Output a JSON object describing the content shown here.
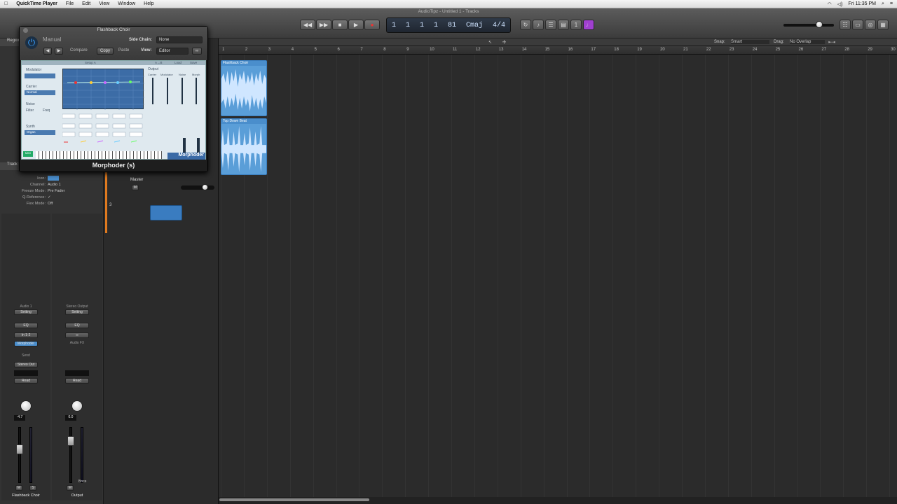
{
  "menubar": {
    "apple": "",
    "app": "QuickTime Player",
    "items": [
      "File",
      "Edit",
      "View",
      "Window",
      "Help"
    ],
    "clock": "Fri 11:35 PM"
  },
  "window_title": "AudioTipz - Untitled 1 - Tracks",
  "lcd": {
    "bar": "1",
    "beat": "1",
    "div": "1",
    "tick": "1",
    "tempo": "81",
    "key": "Cmaj",
    "sig": "4/4"
  },
  "toolbar": {
    "snap_label": "Snap:",
    "snap_value": "Smart",
    "drag_label": "Drag:",
    "drag_value": "No Overlap"
  },
  "plugin": {
    "title": "Flashback Choir",
    "preset": "Manual",
    "side_chain_label": "Side Chain:",
    "side_chain_value": "None",
    "compare": "Compare",
    "copy": "Copy",
    "paste": "Paste",
    "view_label": "View:",
    "view_value": "Editor",
    "setup": "Setup A",
    "load": "Load",
    "save": "Save",
    "ab": "A→B",
    "modulator": "Modulator",
    "carrier": "Carrier",
    "carrier_value": "Normal",
    "noise": "Noise",
    "filter": "Filter",
    "freq": "Freq",
    "synth": "Synth",
    "synth_value": "Organ",
    "output": "Output",
    "output_cols": [
      "Carrier",
      "Modulator",
      "Noise",
      "Morph"
    ],
    "brand": "Morphoder",
    "name": "Morphoder (s)"
  },
  "inspector": {
    "header": "Region",
    "track_header": "Track",
    "rows": [
      {
        "k": "Icon:",
        "v": ""
      },
      {
        "k": "Channel:",
        "v": "Audio 1"
      },
      {
        "k": "Freeze Mode:",
        "v": "Pre Fader"
      },
      {
        "k": "Q-Reference:",
        "v": "✓"
      },
      {
        "k": "Flex Mode:",
        "v": "Off"
      }
    ],
    "strip1": {
      "name": "Flashback Choir",
      "channel": "Audio 1",
      "setting": "Setting",
      "eq": "EQ",
      "input": "In 1-2",
      "plugin": "Morphoder",
      "send": "Send",
      "output": "Stereo Out",
      "mode": "Read",
      "vol": "-4.7",
      "m": "M",
      "s": "S",
      "i": "I",
      "r": "R"
    },
    "strip2": {
      "name": "Output",
      "channel": "Stereo Output",
      "setting": "Setting",
      "eq": "EQ",
      "link": "Audio FX",
      "mode": "Read",
      "vol": "0.0",
      "m": "M",
      "bnce": "Bnce"
    }
  },
  "tracks": {
    "master_label": "Master",
    "master_m": "M",
    "track_num": "3"
  },
  "ruler": [
    "1",
    "2",
    "3",
    "4",
    "5",
    "6",
    "7",
    "8",
    "9",
    "10",
    "11",
    "12",
    "13",
    "14",
    "15",
    "16",
    "17",
    "18",
    "19",
    "20",
    "21",
    "22",
    "23",
    "24",
    "25",
    "26",
    "27",
    "28",
    "29",
    "30"
  ],
  "regions": [
    {
      "name": "Flashback Choir"
    },
    {
      "name": "Top Down Beat"
    }
  ]
}
